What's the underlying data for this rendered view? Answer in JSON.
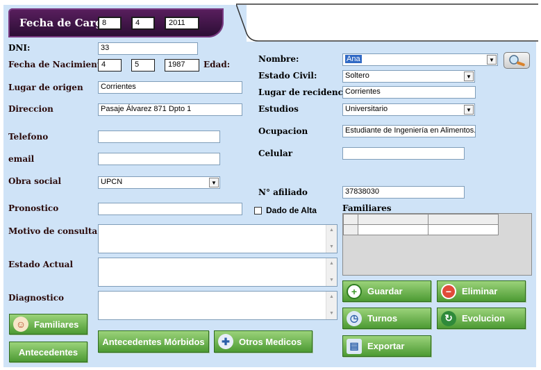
{
  "header": {
    "title": "Fecha de Carga",
    "day": "8",
    "month": "4",
    "year": "2011"
  },
  "left": {
    "dni_label": "DNI:",
    "dni_value": "33",
    "birth_label": "Fecha de Nacimiento",
    "birth_day": "4",
    "birth_month": "5",
    "birth_year": "1987",
    "age_label": "Edad:",
    "origin_label": "Lugar de origen",
    "origin_value": "Corrientes",
    "address_label": "Direccion",
    "address_value": "Pasaje Álvarez 871 Dpto 1",
    "phone_label": "Telefono",
    "phone_value": "",
    "email_label": "email",
    "email_value": "",
    "insurance_label": "Obra social",
    "insurance_value": "UPCN",
    "prognosis_label": "Pronostico",
    "prognosis_value": "",
    "reason_label": "Motivo de consulta",
    "current_label": "Estado Actual",
    "diagnosis_label": "Diagnostico"
  },
  "right": {
    "name_label": "Nombre:",
    "name_value": "Ana",
    "civil_label": "Estado Civil:",
    "civil_value": "Soltero",
    "residence_label": "Lugar de recidencia",
    "residence_value": "Corrientes",
    "studies_label": "Estudios",
    "studies_value": "Universitario",
    "occupation_label": "Ocupacion",
    "occupation_value": "Estudiante de Ingeniería en Alimentos. I",
    "cell_label": "Celular",
    "cell_value": "",
    "affiliate_label": "N° afiliado",
    "affiliate_value": "37838030",
    "discharged_label": "Dado de Alta",
    "family_label": "Familiares"
  },
  "buttons": {
    "familiares": "Familiares",
    "antecedentes": "Antecedentes",
    "antecedentes_morbidos": "Antecedentes Mórbidos",
    "otros_medicos": "Otros Medicos",
    "guardar": "Guardar",
    "eliminar": "Eliminar",
    "turnos": "Turnos",
    "evolucion": "Evolucion",
    "exportar": "Exportar"
  },
  "colors": {
    "panel": "#cfe3f7",
    "header": "#4a1a52",
    "button_green": "#5aa63c"
  },
  "icons": [
    "search-icon",
    "people-icon",
    "plus-icon",
    "minus-icon",
    "clock-icon",
    "refresh-icon",
    "export-icon",
    "doctor-icon"
  ]
}
